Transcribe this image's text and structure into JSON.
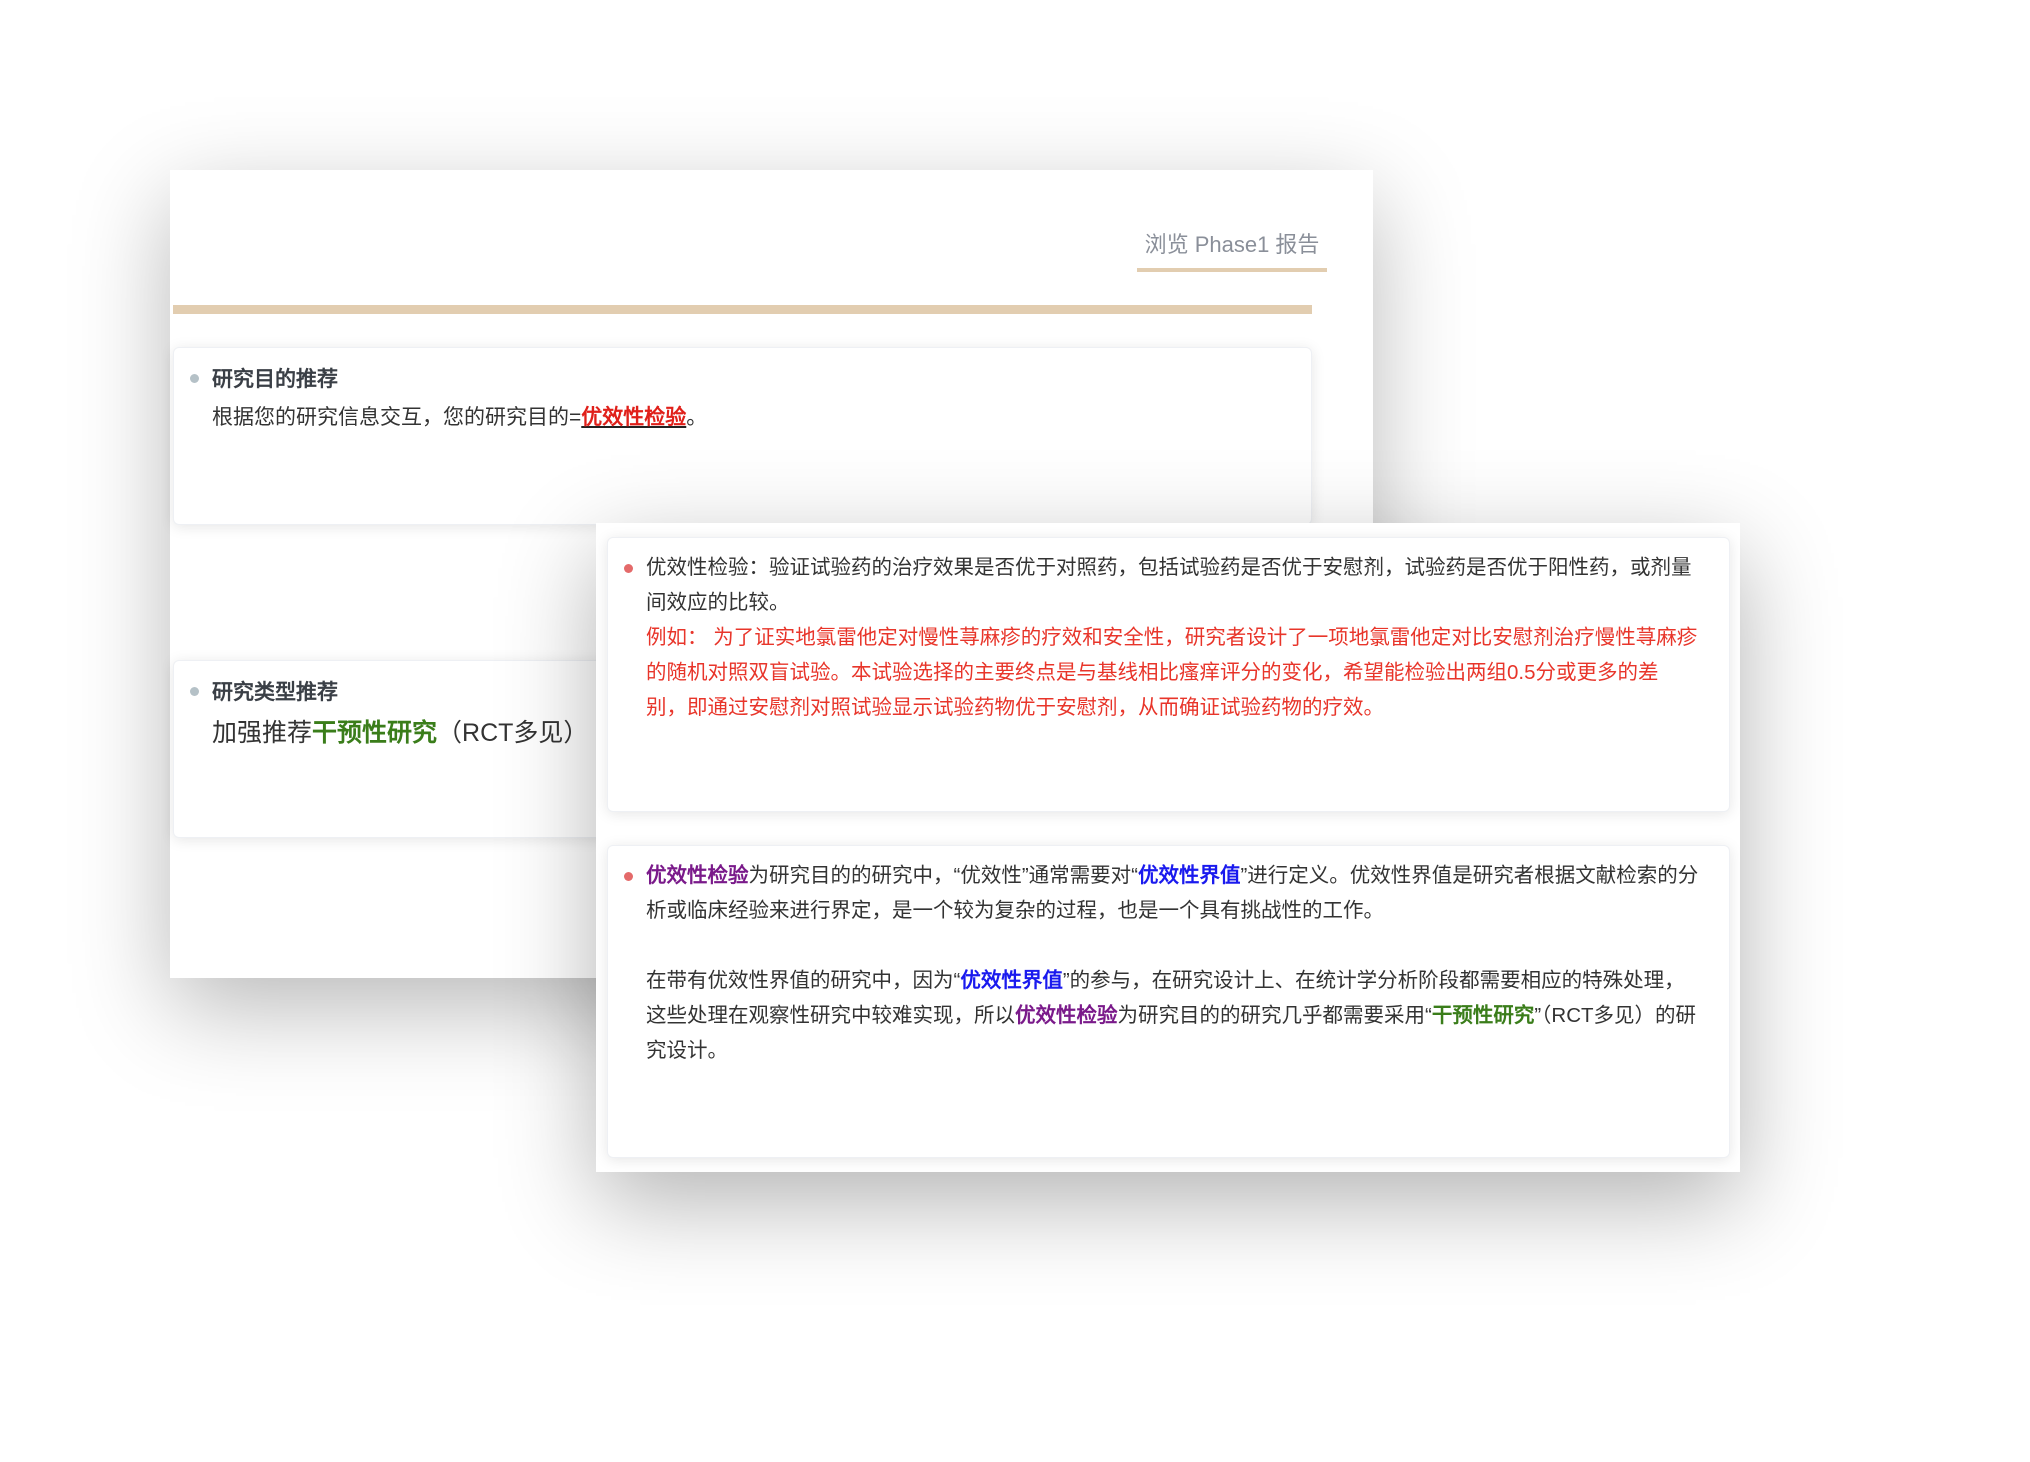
{
  "tab": {
    "label": "浏览 Phase1 报告"
  },
  "colors": {
    "accent": "#e2cdb0",
    "red": "#e8352a",
    "purple": "#7a1a8a",
    "blue": "#1a1aee",
    "green": "#3a7d1a"
  },
  "purpose": {
    "title": "研究目的推荐",
    "prefix": "根据您的研究信息交互，您的研究目的=",
    "value": "优效性检验",
    "suffix": "。"
  },
  "type": {
    "title": "研究类型推荐",
    "prefix": "加强推荐",
    "value": "干预性研究",
    "suffix": "（RCT多见）"
  },
  "definition": {
    "term": "优效性检验：",
    "text": "验证试验药的治疗效果是否优于对照药，包括试验药是否优于安慰剂，试验药是否优于阳性药，或剂量间效应的比较。",
    "example": "例如：  为了证实地氯雷他定对慢性荨麻疹的疗效和安全性，研究者设计了一项地氯雷他定对比安慰剂治疗慢性荨麻疹的随机对照双盲试验。本试验选择的主要终点是与基线相比瘙痒评分的变化，希望能检验出两组0.5分或更多的差别，即通过安慰剂对照试验显示试验药物优于安慰剂，从而确证试验药物的疗效。"
  },
  "margin": {
    "p1": [
      "优效性检验",
      "为研究目的的研究中，“优效性”通常需要对“",
      "优效性界值",
      "”进行定义。优效性界值是研究者根据文献检索的分析或临床经验来进行界定，是一个较为复杂的过程，也是一个具有挑战性的工作。"
    ],
    "p2": [
      "在带有优效性界值的研究中，因为“",
      "优效性界值",
      "”的参与，在研究设计上、在统计学分析阶段都需要相应的特殊处理，这些处理在观察性研究中较难实现，所以",
      "优效性检验",
      "为研究目的的研究几乎都需要采用“",
      "干预性研究",
      "”（RCT多见）的研究设计。"
    ]
  }
}
